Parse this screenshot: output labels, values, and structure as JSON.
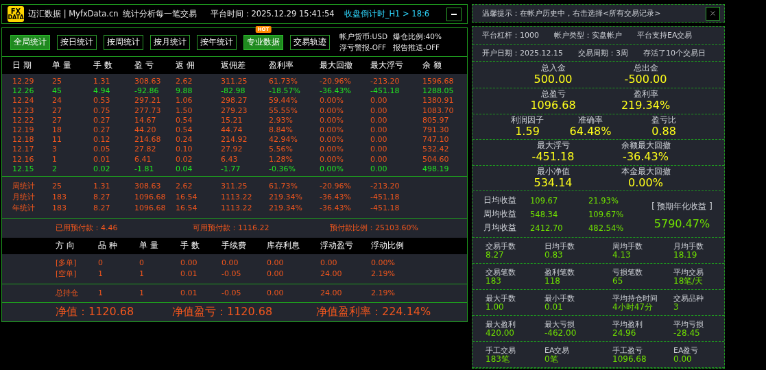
{
  "header": {
    "logo": [
      "FX",
      "DATA"
    ],
    "title": "迈汇数据 | MyfxData.cn",
    "slogan": "统计分析每一笔交易",
    "time": "平台时间：2025.12.29 15:41:54",
    "countdown": "收盘倒计时_H1 > 18:6"
  },
  "tabs": [
    {
      "label": "全局统计",
      "selected": true
    },
    {
      "label": "按日统计",
      "selected": false
    },
    {
      "label": "按周统计",
      "selected": false
    },
    {
      "label": "按月统计",
      "selected": false
    },
    {
      "label": "按年统计",
      "selected": false
    },
    {
      "label": "专业数据",
      "selected": true,
      "badge": "HOT"
    },
    {
      "label": "交易轨迹",
      "selected": false
    }
  ],
  "account_flags": [
    "帐户货币:USD",
    "爆仓比例:40%",
    "浮亏警报-OFF",
    "报告推送-OFF"
  ],
  "table": {
    "columns": [
      "日 期",
      "单 量",
      "手 数",
      "盈 亏",
      "返 佣",
      "返佣差",
      "盈利率",
      "最大回撤",
      "最大浮亏",
      "余 额"
    ],
    "rows": [
      {
        "loss": false,
        "cells": [
          "12.29",
          "25",
          "1.31",
          "308.63",
          "2.62",
          "311.25",
          "61.73%",
          "-20.96%",
          "-213.20",
          "1596.68"
        ]
      },
      {
        "loss": true,
        "cells": [
          "12.26",
          "45",
          "4.94",
          "-92.86",
          "9.88",
          "-82.98",
          "-18.57%",
          "-36.43%",
          "-451.18",
          "1288.05"
        ]
      },
      {
        "loss": false,
        "cells": [
          "12.24",
          "24",
          "0.53",
          "297.21",
          "1.06",
          "298.27",
          "59.44%",
          "0.00%",
          "0.00",
          "1380.91"
        ]
      },
      {
        "loss": false,
        "cells": [
          "12.23",
          "27",
          "0.75",
          "277.73",
          "1.50",
          "279.23",
          "55.55%",
          "0.00%",
          "0.00",
          "1083.70"
        ]
      },
      {
        "loss": false,
        "cells": [
          "12.22",
          "27",
          "0.27",
          "14.67",
          "0.54",
          "15.21",
          "2.93%",
          "0.00%",
          "0.00",
          "805.97"
        ]
      },
      {
        "loss": false,
        "cells": [
          "12.19",
          "18",
          "0.27",
          "44.20",
          "0.54",
          "44.74",
          "8.84%",
          "0.00%",
          "0.00",
          "791.30"
        ]
      },
      {
        "loss": false,
        "cells": [
          "12.18",
          "11",
          "0.12",
          "214.68",
          "0.24",
          "214.92",
          "42.94%",
          "0.00%",
          "0.00",
          "747.10"
        ]
      },
      {
        "loss": false,
        "cells": [
          "12.17",
          "3",
          "0.05",
          "27.82",
          "0.10",
          "27.92",
          "5.56%",
          "0.00%",
          "0.00",
          "532.42"
        ]
      },
      {
        "loss": false,
        "cells": [
          "12.16",
          "1",
          "0.01",
          "6.41",
          "0.02",
          "6.43",
          "1.28%",
          "0.00%",
          "0.00",
          "504.60"
        ]
      },
      {
        "loss": true,
        "cells": [
          "12.15",
          "2",
          "0.02",
          "-1.81",
          "0.04",
          "-1.77",
          "-0.36%",
          "0.00%",
          "0.00",
          "498.19"
        ]
      }
    ],
    "summary": [
      [
        "周统计",
        "25",
        "1.31",
        "308.63",
        "2.62",
        "311.25",
        "61.73%",
        "-20.96%",
        "-213.20"
      ],
      [
        "月统计",
        "183",
        "8.27",
        "1096.68",
        "16.54",
        "1113.22",
        "219.34%",
        "-36.43%",
        "-451.18"
      ],
      [
        "年统计",
        "183",
        "8.27",
        "1096.68",
        "16.54",
        "1113.22",
        "219.34%",
        "-36.43%",
        "-451.18"
      ]
    ]
  },
  "prepay": [
    "已用预付款：4.46",
    "可用预付款：1116.22",
    "预付款比例：25103.60%"
  ],
  "positions": {
    "columns": [
      "方 向",
      "品 种",
      "单 量",
      "手 数",
      "手续费",
      "库存利息",
      "浮动盈亏",
      "浮动比例"
    ],
    "rows": [
      [
        "[多单]",
        "0",
        "0",
        "0.00",
        "0.00",
        "0.00",
        "0.00",
        "0.00%"
      ],
      [
        "[空单]",
        "1",
        "1",
        "0.01",
        "-0.05",
        "0.00",
        "24.00",
        "2.19%"
      ]
    ],
    "total": [
      "总持仓",
      "1",
      "1",
      "0.01",
      "-0.05",
      "0.00",
      "24.00",
      "2.19%"
    ]
  },
  "net": [
    "净值：1120.68",
    "净值盈亏：1120.68",
    "净值盈利率：224.14%"
  ],
  "side": {
    "notice": "温馨提示：在帐户历史中，右击选择<所有交易记录>",
    "info_rows": [
      [
        "平台杠杆：1000",
        "帐户类型：实盘帐户",
        "平台支持EA交易"
      ],
      [
        "开户日期：2025.12.15",
        "交易周期：3周",
        "存活了10个交易日"
      ]
    ],
    "big_stats": [
      [
        {
          "label": "总入金",
          "value": "500.00"
        },
        {
          "label": "总出金",
          "value": "-500.00"
        }
      ],
      [
        {
          "label": "总盈亏",
          "value": "1096.68"
        },
        {
          "label": "盈利率",
          "value": "219.34%"
        }
      ],
      [
        {
          "label": "利润因子",
          "value": "1.59"
        },
        {
          "label": "准确率",
          "value": "64.48%"
        },
        {
          "label": "盈亏比",
          "value": "0.88"
        }
      ],
      [
        {
          "label": "最大浮亏",
          "value": "-451.18"
        },
        {
          "label": "余额最大回撤",
          "value": "-36.43%"
        }
      ],
      [
        {
          "label": "最小净值",
          "value": "534.14"
        },
        {
          "label": "本金最大回撤",
          "value": "0.00%"
        }
      ]
    ],
    "income": [
      {
        "label": "日均收益",
        "amount": "109.67",
        "pct": "21.93%"
      },
      {
        "label": "周均收益",
        "amount": "548.34",
        "pct": "109.67%"
      },
      {
        "label": "月均收益",
        "amount": "2412.70",
        "pct": "482.54%"
      }
    ],
    "annual": {
      "label": "[ 预期年化收益 ]",
      "value": "5790.47%"
    },
    "grid": [
      [
        {
          "label": "交易手数",
          "value": "8.27"
        },
        {
          "label": "日均手数",
          "value": "0.83"
        },
        {
          "label": "周均手数",
          "value": "4.13"
        },
        {
          "label": "月均手数",
          "value": "18.19"
        }
      ],
      [
        {
          "label": "交易笔数",
          "value": "183"
        },
        {
          "label": "盈利笔数",
          "value": "118"
        },
        {
          "label": "亏损笔数",
          "value": "65"
        },
        {
          "label": "平均交易",
          "value": "18笔/天"
        }
      ],
      [
        {
          "label": "最大手数",
          "value": "1.00"
        },
        {
          "label": "最小手数",
          "value": "0.01"
        },
        {
          "label": "平均持仓时间",
          "value": "4小时47分"
        },
        {
          "label": "交易品种",
          "value": "3"
        }
      ],
      [
        {
          "label": "最大盈利",
          "value": "420.00"
        },
        {
          "label": "最大亏损",
          "value": "-462.00"
        },
        {
          "label": "平均盈利",
          "value": "24.96"
        },
        {
          "label": "平均亏损",
          "value": "-28.45"
        }
      ],
      [
        {
          "label": "手工交易",
          "value": "183笔"
        },
        {
          "label": "EA交易",
          "value": "0笔"
        },
        {
          "label": "手工盈亏",
          "value": "1096.68"
        },
        {
          "label": "EA盈亏",
          "value": "0.00"
        }
      ]
    ]
  }
}
